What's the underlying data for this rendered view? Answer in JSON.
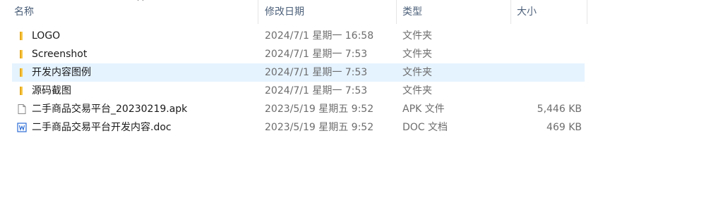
{
  "columns": {
    "name": "名称",
    "modified": "修改日期",
    "type": "类型",
    "size": "大小"
  },
  "files": [
    {
      "name": "LOGO",
      "modified": "2024/7/1 星期一 16:58",
      "type": "文件夹",
      "size": "",
      "icon": "folder-icon"
    },
    {
      "name": "Screenshot",
      "modified": "2024/7/1 星期一 7:53",
      "type": "文件夹",
      "size": "",
      "icon": "folder-icon"
    },
    {
      "name": "开发内容图例",
      "modified": "2024/7/1 星期一 7:53",
      "type": "文件夹",
      "size": "",
      "icon": "folder-icon",
      "selected": true
    },
    {
      "name": "源码截图",
      "modified": "2024/7/1 星期一 7:53",
      "type": "文件夹",
      "size": "",
      "icon": "folder-icon"
    },
    {
      "name": "二手商品交易平台_20230219.apk",
      "modified": "2023/5/19 星期五 9:52",
      "type": "APK 文件",
      "size": "5,446 KB",
      "icon": "file-icon"
    },
    {
      "name": "二手商品交易平台开发内容.doc",
      "modified": "2023/5/19 星期五 9:52",
      "type": "DOC 文档",
      "size": "469 KB",
      "icon": "word-doc-icon"
    }
  ],
  "colors": {
    "header_text": "#4c607a",
    "selected_row": "#e5f3ff",
    "folder": "#f8c94a"
  }
}
